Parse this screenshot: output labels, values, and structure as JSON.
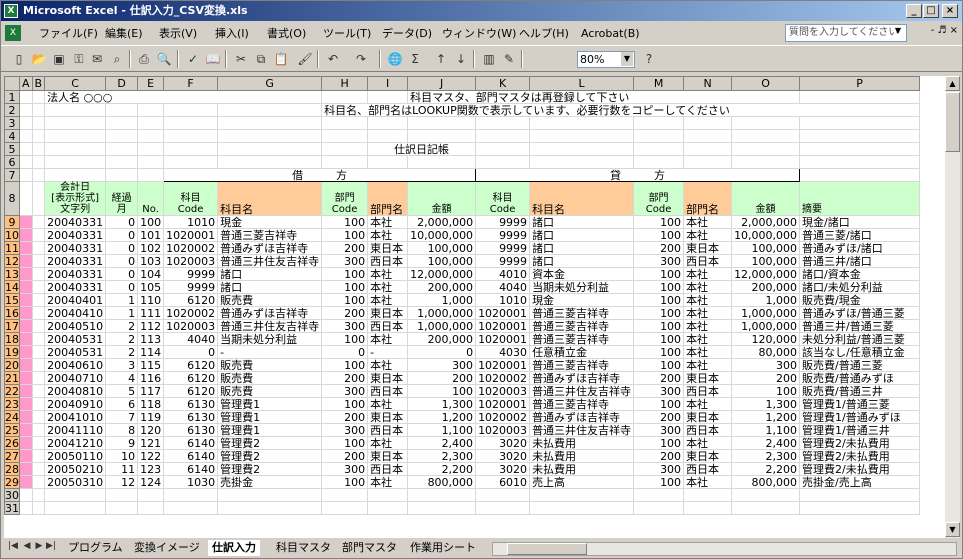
{
  "window": {
    "title": "Microsoft Excel - 仕訳入力_CSV変換.xls",
    "app_icon": "X",
    "minimize": "_",
    "maximize": "□",
    "close": "×"
  },
  "menu": {
    "items": [
      "ファイル(F)",
      "編集(E)",
      "表示(V)",
      "挿入(I)",
      "書式(O)",
      "ツール(T)",
      "データ(D)",
      "ウィンドウ(W)",
      "ヘルプ(H)",
      "Acrobat(B)"
    ],
    "help_placeholder": "質問を入力してください",
    "child_controls": "- ♬ ×"
  },
  "toolbar": {
    "zoom": "80%"
  },
  "columns": [
    "A",
    "B",
    "C",
    "D",
    "E",
    "F",
    "G",
    "H",
    "I",
    "J",
    "K",
    "L",
    "M",
    "N",
    "O",
    "P"
  ],
  "header_text": {
    "r1_c": "法人名 ○○○",
    "r1_h": "科目マスタ、部門マスタは再登録して下さい",
    "r2_h": "科目名、部門名はLOOKUP関数で表示しています、必要行数をコピーしてください",
    "r6_title": "仕訳日記帳",
    "r7_debit": "借　　　方",
    "r7_credit": "貸　　　方",
    "r8": {
      "date": "会計日\n[表示形式]\n文字列",
      "elapsed": "経過\n月",
      "no": "No.",
      "code": "科目\nCode",
      "name": "科目名",
      "dept_code": "部門\nCode",
      "dept_name": "部門名",
      "amount": "金額",
      "memo": "摘要"
    }
  },
  "rows": [
    {
      "r": "9",
      "date": "20040331",
      "m": "0",
      "no": "100",
      "dc": "1010",
      "dn": "現金",
      "ddc": "100",
      "ddn": "本社",
      "da": "2,000,000",
      "cc": "9999",
      "cn": "諸口",
      "cdc": "100",
      "cdn": "本社",
      "ca": "2,000,000",
      "memo": "現金/諸口"
    },
    {
      "r": "10",
      "date": "20040331",
      "m": "0",
      "no": "101",
      "dc": "1020001",
      "dn": "普通三菱吉祥寺",
      "ddc": "100",
      "ddn": "本社",
      "da": "10,000,000",
      "cc": "9999",
      "cn": "諸口",
      "cdc": "100",
      "cdn": "本社",
      "ca": "10,000,000",
      "memo": "普通三菱/諸口"
    },
    {
      "r": "11",
      "date": "20040331",
      "m": "0",
      "no": "102",
      "dc": "1020002",
      "dn": "普通みずほ吉祥寺",
      "ddc": "200",
      "ddn": "東日本",
      "da": "100,000",
      "cc": "9999",
      "cn": "諸口",
      "cdc": "200",
      "cdn": "東日本",
      "ca": "100,000",
      "memo": "普通みずほ/諸口"
    },
    {
      "r": "12",
      "date": "20040331",
      "m": "0",
      "no": "103",
      "dc": "1020003",
      "dn": "普通三井住友吉祥寺",
      "ddc": "300",
      "ddn": "西日本",
      "da": "100,000",
      "cc": "9999",
      "cn": "諸口",
      "cdc": "300",
      "cdn": "西日本",
      "ca": "100,000",
      "memo": "普通三井/諸口"
    },
    {
      "r": "13",
      "date": "20040331",
      "m": "0",
      "no": "104",
      "dc": "9999",
      "dn": "諸口",
      "ddc": "100",
      "ddn": "本社",
      "da": "12,000,000",
      "cc": "4010",
      "cn": "資本金",
      "cdc": "100",
      "cdn": "本社",
      "ca": "12,000,000",
      "memo": "諸口/資本金"
    },
    {
      "r": "14",
      "date": "20040331",
      "m": "0",
      "no": "105",
      "dc": "9999",
      "dn": "諸口",
      "ddc": "100",
      "ddn": "本社",
      "da": "200,000",
      "cc": "4040",
      "cn": "当期未処分利益",
      "cdc": "100",
      "cdn": "本社",
      "ca": "200,000",
      "memo": "諸口/未処分利益"
    },
    {
      "r": "15",
      "date": "20040401",
      "m": "1",
      "no": "110",
      "dc": "6120",
      "dn": "販売費",
      "ddc": "100",
      "ddn": "本社",
      "da": "1,000",
      "cc": "1010",
      "cn": "現金",
      "cdc": "100",
      "cdn": "本社",
      "ca": "1,000",
      "memo": "販売費/現金"
    },
    {
      "r": "16",
      "date": "20040410",
      "m": "1",
      "no": "111",
      "dc": "1020002",
      "dn": "普通みずほ吉祥寺",
      "ddc": "200",
      "ddn": "東日本",
      "da": "1,000,000",
      "cc": "1020001",
      "cn": "普通三菱吉祥寺",
      "cdc": "100",
      "cdn": "本社",
      "ca": "1,000,000",
      "memo": "普通みずほ/普通三菱"
    },
    {
      "r": "17",
      "date": "20040510",
      "m": "2",
      "no": "112",
      "dc": "1020003",
      "dn": "普通三井住友吉祥寺",
      "ddc": "300",
      "ddn": "西日本",
      "da": "1,000,000",
      "cc": "1020001",
      "cn": "普通三菱吉祥寺",
      "cdc": "100",
      "cdn": "本社",
      "ca": "1,000,000",
      "memo": "普通三井/普通三菱"
    },
    {
      "r": "18",
      "date": "20040531",
      "m": "2",
      "no": "113",
      "dc": "4040",
      "dn": "当期未処分利益",
      "ddc": "100",
      "ddn": "本社",
      "da": "200,000",
      "cc": "1020001",
      "cn": "普通三菱吉祥寺",
      "cdc": "100",
      "cdn": "本社",
      "ca": "120,000",
      "memo": "未処分利益/普通三菱"
    },
    {
      "r": "19",
      "date": "20040531",
      "m": "2",
      "no": "114",
      "dc": "0",
      "dn": "-",
      "ddc": "0",
      "ddn": "-",
      "da": "0",
      "cc": "4030",
      "cn": "任意積立金",
      "cdc": "100",
      "cdn": "本社",
      "ca": "80,000",
      "memo": "該当なし/任意積立金"
    },
    {
      "r": "20",
      "date": "20040610",
      "m": "3",
      "no": "115",
      "dc": "6120",
      "dn": "販売費",
      "ddc": "100",
      "ddn": "本社",
      "da": "300",
      "cc": "1020001",
      "cn": "普通三菱吉祥寺",
      "cdc": "100",
      "cdn": "本社",
      "ca": "300",
      "memo": "販売費/普通三菱"
    },
    {
      "r": "21",
      "date": "20040710",
      "m": "4",
      "no": "116",
      "dc": "6120",
      "dn": "販売費",
      "ddc": "200",
      "ddn": "東日本",
      "da": "200",
      "cc": "1020002",
      "cn": "普通みずほ吉祥寺",
      "cdc": "200",
      "cdn": "東日本",
      "ca": "200",
      "memo": "販売費/普通みずほ"
    },
    {
      "r": "22",
      "date": "20040810",
      "m": "5",
      "no": "117",
      "dc": "6120",
      "dn": "販売費",
      "ddc": "300",
      "ddn": "西日本",
      "da": "100",
      "cc": "1020003",
      "cn": "普通三井住友吉祥寺",
      "cdc": "300",
      "cdn": "西日本",
      "ca": "100",
      "memo": "販売費/普通三井"
    },
    {
      "r": "23",
      "date": "20040910",
      "m": "6",
      "no": "118",
      "dc": "6130",
      "dn": "管理費1",
      "ddc": "100",
      "ddn": "本社",
      "da": "1,300",
      "cc": "1020001",
      "cn": "普通三菱吉祥寺",
      "cdc": "100",
      "cdn": "本社",
      "ca": "1,300",
      "memo": "管理費1/普通三菱"
    },
    {
      "r": "24",
      "date": "20041010",
      "m": "7",
      "no": "119",
      "dc": "6130",
      "dn": "管理費1",
      "ddc": "200",
      "ddn": "東日本",
      "da": "1,200",
      "cc": "1020002",
      "cn": "普通みずほ吉祥寺",
      "cdc": "200",
      "cdn": "東日本",
      "ca": "1,200",
      "memo": "管理費1/普通みずほ"
    },
    {
      "r": "25",
      "date": "20041110",
      "m": "8",
      "no": "120",
      "dc": "6130",
      "dn": "管理費1",
      "ddc": "300",
      "ddn": "西日本",
      "da": "1,100",
      "cc": "1020003",
      "cn": "普通三井住友吉祥寺",
      "cdc": "300",
      "cdn": "西日本",
      "ca": "1,100",
      "memo": "管理費1/普通三井"
    },
    {
      "r": "26",
      "date": "20041210",
      "m": "9",
      "no": "121",
      "dc": "6140",
      "dn": "管理費2",
      "ddc": "100",
      "ddn": "本社",
      "da": "2,400",
      "cc": "3020",
      "cn": "未払費用",
      "cdc": "100",
      "cdn": "本社",
      "ca": "2,400",
      "memo": "管理費2/未払費用"
    },
    {
      "r": "27",
      "date": "20050110",
      "m": "10",
      "no": "122",
      "dc": "6140",
      "dn": "管理費2",
      "ddc": "200",
      "ddn": "東日本",
      "da": "2,300",
      "cc": "3020",
      "cn": "未払費用",
      "cdc": "200",
      "cdn": "東日本",
      "ca": "2,300",
      "memo": "管理費2/未払費用"
    },
    {
      "r": "28",
      "date": "20050210",
      "m": "11",
      "no": "123",
      "dc": "6140",
      "dn": "管理費2",
      "ddc": "300",
      "ddn": "西日本",
      "da": "2,200",
      "cc": "3020",
      "cn": "未払費用",
      "cdc": "300",
      "cdn": "西日本",
      "ca": "2,200",
      "memo": "管理費2/未払費用"
    },
    {
      "r": "29",
      "date": "20050310",
      "m": "12",
      "no": "124",
      "dc": "1030",
      "dn": "売掛金",
      "ddc": "100",
      "ddn": "本社",
      "da": "800,000",
      "cc": "6010",
      "cn": "売上高",
      "cdc": "100",
      "cdn": "本社",
      "ca": "800,000",
      "memo": "売掛金/売上高"
    }
  ],
  "tabs": [
    "プログラム",
    "変換イメージ",
    "仕訳入力",
    "科目マスタ",
    "部門マスタ",
    "作業用シート"
  ],
  "active_tab": "仕訳入力",
  "colors": {
    "pink": "#ff99cc",
    "green": "#ccffcc",
    "orange": "#ffcc99",
    "titlebar": "#0a246a"
  }
}
